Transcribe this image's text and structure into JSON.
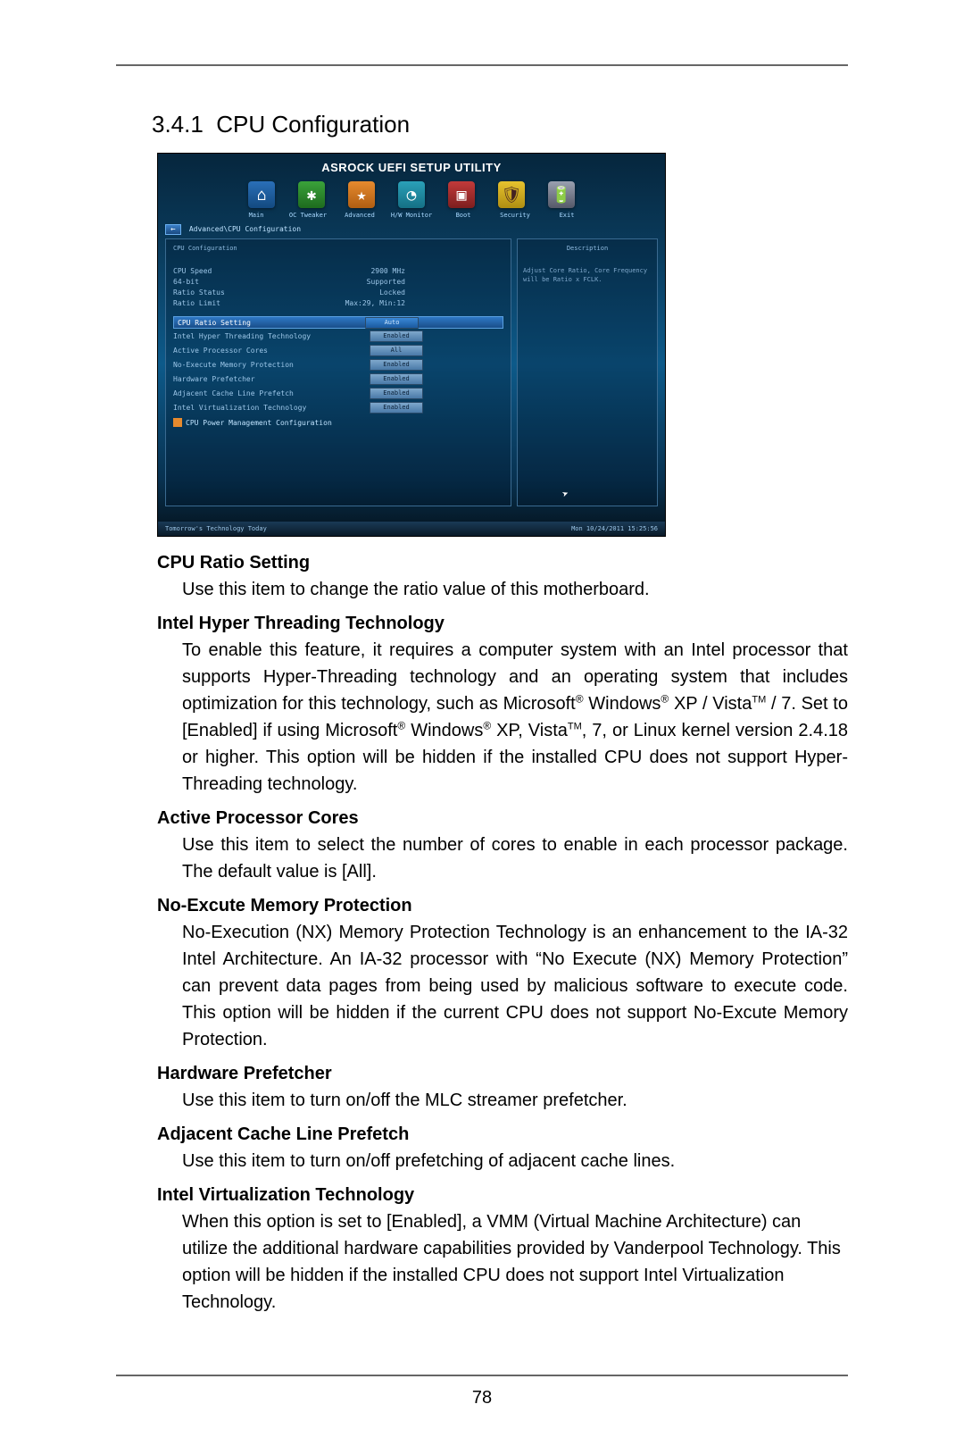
{
  "section": {
    "number": "3.4.1",
    "title": "CPU Configuration"
  },
  "page_number": "78",
  "bios": {
    "title": "ASROCK UEFI SETUP UTILITY",
    "tabs": [
      "Main",
      "OC Tweaker",
      "Advanced",
      "H/W Monitor",
      "Boot",
      "Security",
      "Exit"
    ],
    "breadcrumb": "Advanced\\CPU Configuration",
    "left_header": "CPU Configuration",
    "right_header": "Description",
    "info": [
      {
        "label": "CPU Speed",
        "value": "2900 MHz"
      },
      {
        "label": "64-bit",
        "value": "Supported"
      },
      {
        "label": "Ratio Status",
        "value": "Locked"
      },
      {
        "label": "Ratio Limit",
        "value": "Max:29, Min:12"
      }
    ],
    "highlight": {
      "label": "CPU Ratio Setting",
      "value": "Auto"
    },
    "settings": [
      {
        "label": "Intel Hyper Threading Technology",
        "value": "Enabled"
      },
      {
        "label": "Active Processor Cores",
        "value": "All"
      },
      {
        "label": "No-Execute Memory Protection",
        "value": "Enabled"
      },
      {
        "label": "Hardware Prefetcher",
        "value": "Enabled"
      },
      {
        "label": "Adjacent Cache Line Prefetch",
        "value": "Enabled"
      },
      {
        "label": "Intel Virtualization Technology",
        "value": "Enabled"
      }
    ],
    "submenu": "CPU Power Management Configuration",
    "description": "Adjust Core Ratio, Core Frequency will be Ratio x FCLK.",
    "footer_left": "Tomorrow's Technology Today",
    "footer_right": "Mon 10/24/2011  15:25:56"
  },
  "doc": [
    {
      "heading": "CPU Ratio Setting",
      "text": "Use this item to change the ratio value of this motherboard.",
      "justify": false
    },
    {
      "heading": "Intel Hyper Threading Technology",
      "text": "To enable this feature, it requires a computer system with an Intel processor that supports Hyper-Threading technology and an operating system that includes optimization for this technology, such as Microsoft® Windows® XP / Vista™ / 7. Set to [Enabled] if using Microsoft® Windows® XP, Vista™, 7, or Linux kernel version 2.4.18 or higher. This option will be hidden if the installed CPU does not support Hyper-Threading technology.",
      "justify": true
    },
    {
      "heading": "Active Processor Cores",
      "text": "Use this item to select the number of cores to enable in each processor package. The default value is [All].",
      "justify": true
    },
    {
      "heading": "No-Excute Memory Protection",
      "text": "No-Execution (NX) Memory Protection Technology is an enhancement to the IA-32 Intel Architecture. An IA-32 processor with “No Execute (NX) Memory Protection” can prevent data pages from being used by malicious software to execute code. This option will be hidden if the current CPU does not support No-Excute Memory Protection.",
      "justify": true
    },
    {
      "heading": "Hardware Prefetcher",
      "text": "Use this item to turn on/off the MLC streamer prefetcher.",
      "justify": false
    },
    {
      "heading": "Adjacent Cache Line Prefetch",
      "text": "Use this item to turn on/off prefetching of adjacent cache lines.",
      "justify": false
    },
    {
      "heading": "Intel Virtualization Technology",
      "text": "When this option is set to [Enabled], a VMM (Virtual Machine Architecture) can utilize the additional hardware capabilities provided by Vanderpool Technology. This option will be hidden if the installed CPU does not support Intel Virtualization Technology.",
      "justify": false
    }
  ]
}
